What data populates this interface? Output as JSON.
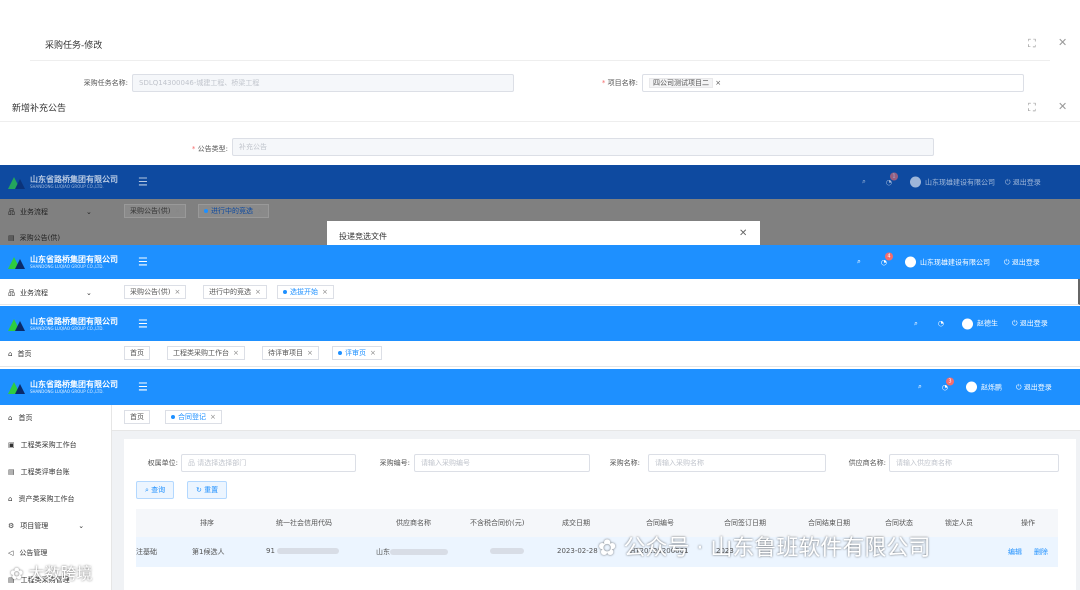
{
  "dialog1": {
    "title": "采购任务-修改",
    "task_name_label": "采购任务名称:",
    "task_name_value": "SDLQ14300046-城建工程、桥梁工程",
    "project_label": "项目名称:",
    "project_tag": "四公司测试项目二"
  },
  "dialog2": {
    "title": "新增补充公告",
    "type_label": "公告类型:",
    "type_value": "补充公告"
  },
  "company": {
    "name": "山东省路桥集团有限公司",
    "name_en": "SHANDONG LUQIAO GROUP CO.,LTD."
  },
  "frame1": {
    "user": "山东现雄建设有限公司",
    "logout": "退出登录",
    "badge": "1",
    "side_item": "业务流程",
    "side_item2": "采购公告(供)",
    "tabs": [
      "采购公告(供)",
      "进行中的竞选"
    ],
    "modal_title": "投递竞选文件"
  },
  "frame2": {
    "user": "山东现雄建设有限公司",
    "logout": "退出登录",
    "badge": "4",
    "side_item": "业务流程",
    "tabs": [
      "采购公告(供)",
      "进行中的竞选",
      "选拔开始"
    ]
  },
  "frame3": {
    "user": "赵德生",
    "logout": "退出登录",
    "side_item": "首页",
    "tabs": [
      "首页",
      "工程类采购工作台",
      "待评审项目",
      "评审页"
    ]
  },
  "frame4": {
    "user": "赵烁鹏",
    "logout": "退出登录",
    "badge": "3",
    "tabs": [
      "首页",
      "合同登记"
    ],
    "sidebar": [
      "首页",
      "工程类采购工作台",
      "工程类评审台账",
      "资产类采购工作台",
      "项目管理",
      "公告管理",
      "工程类采购管理"
    ],
    "filters": [
      {
        "label": "权属单位:",
        "placeholder": "请选择选择部门"
      },
      {
        "label": "采购编号:",
        "placeholder": "请输入采购编号"
      },
      {
        "label": "采购名称:",
        "placeholder": "请输入采购名称"
      },
      {
        "label": "供应商名称:",
        "placeholder": "请输入供应商名称"
      }
    ],
    "search_btn": "查询",
    "reset_btn": "重置",
    "columns": [
      "排序",
      "统一社会信用代码",
      "供应商名称",
      "不含税合同价(元)",
      "成交日期",
      "合同编号",
      "合同签订日期",
      "合同结束日期",
      "合同状态",
      "锁定人员",
      "操作"
    ],
    "row": {
      "unit": "注基础",
      "rank": "第1候选人",
      "code": "91",
      "supplier": "山东",
      "date": "2023-02-28",
      "contract": "HT20230200001",
      "sign": "2023",
      "actions": [
        "编辑",
        "删除"
      ]
    }
  },
  "watermarks": {
    "left": "大数跨境",
    "right": "公众号 · 山东鲁班软件有限公司"
  }
}
